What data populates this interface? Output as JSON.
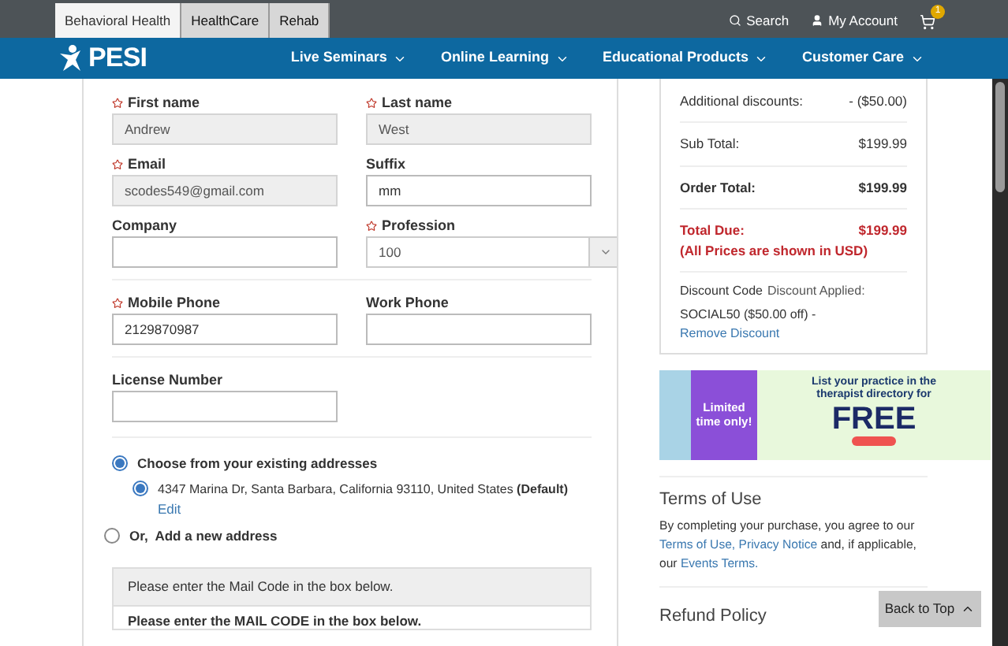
{
  "site_tabs": [
    {
      "label": "Behavioral Health",
      "selected": true
    },
    {
      "label": "HealthCare",
      "selected": false
    },
    {
      "label": "Rehab",
      "selected": false
    }
  ],
  "utility": {
    "search": "Search",
    "account": "My Account",
    "cart_count": "1"
  },
  "nav": {
    "logo": "PESI",
    "items": [
      "Live Seminars",
      "Online Learning",
      "Educational Products",
      "Customer Care"
    ]
  },
  "form": {
    "rows": [
      [
        {
          "label": "First name",
          "required": true,
          "value": "Andrew",
          "disabled": true,
          "kind": "text"
        },
        {
          "label": "Last name",
          "required": true,
          "value": "West",
          "disabled": true,
          "kind": "text"
        }
      ],
      [
        {
          "label": "Email",
          "required": true,
          "value": "scodes549@gmail.com",
          "disabled": true,
          "kind": "text"
        },
        {
          "label": "Suffix",
          "required": false,
          "value": "mm",
          "disabled": false,
          "kind": "text"
        }
      ],
      [
        {
          "label": "Company",
          "required": false,
          "disabled": false,
          "kind": "text"
        },
        {
          "label": "Profession",
          "required": true,
          "value": "100",
          "disabled": false,
          "kind": "select"
        }
      ],
      [
        {
          "label": "Mobile Phone",
          "required": true,
          "value": "2129870987",
          "disabled": false,
          "kind": "text"
        },
        {
          "label": "Work Phone",
          "required": false,
          "disabled": false,
          "kind": "text"
        }
      ],
      [
        {
          "label": "License Number",
          "required": false,
          "disabled": false,
          "kind": "text"
        }
      ]
    ],
    "address_choice": {
      "label": "Choose from your existing addresses",
      "selected": true
    },
    "addresses": [
      {
        "text": "4347 Marina Dr, Santa Barbara, California 93110, United States **(Default)**",
        "selected": true,
        "edit": "Edit"
      }
    ],
    "new_address": {
      "prefix": "Or,",
      "label": "Add a new address",
      "selected": false
    },
    "mail_code_header": "Please enter the Mail Code in the box below.",
    "mail_code_text": "Please enter the MAIL CODE in the box below."
  },
  "summary": {
    "rows": [
      {
        "label": "Additional discounts:",
        "value": "- ($50.00)",
        "kind": "plain"
      },
      {
        "label": "Sub Total:",
        "value": "$199.99",
        "kind": "sub"
      },
      {
        "label": "Order Total:",
        "value": "$199.99",
        "kind": "total"
      },
      {
        "label": "Total Due:",
        "value": "$199.99",
        "kind": "due"
      }
    ],
    "currency_note": "(All Prices are shown in USD)",
    "discount_label": "Discount Code",
    "discount_applied": "Discount Applied:",
    "discount_code": "SOCIAL50 ($50.00 off) -",
    "remove": "Remove Discount"
  },
  "banner": {
    "badge": "Limited time only!",
    "headline": "List your practice in the therapist directory for",
    "big": "FREE"
  },
  "terms": {
    "title": "Terms of Use",
    "text_before": "By completing your purchase, you agree to our",
    "link1": "Terms of Use,",
    "link2": "Privacy Notice",
    "text_mid": "and, if applicable, our",
    "link3": "Events Terms."
  },
  "refund": {
    "title": "Refund Policy"
  },
  "back_to_top": "Back to Top"
}
